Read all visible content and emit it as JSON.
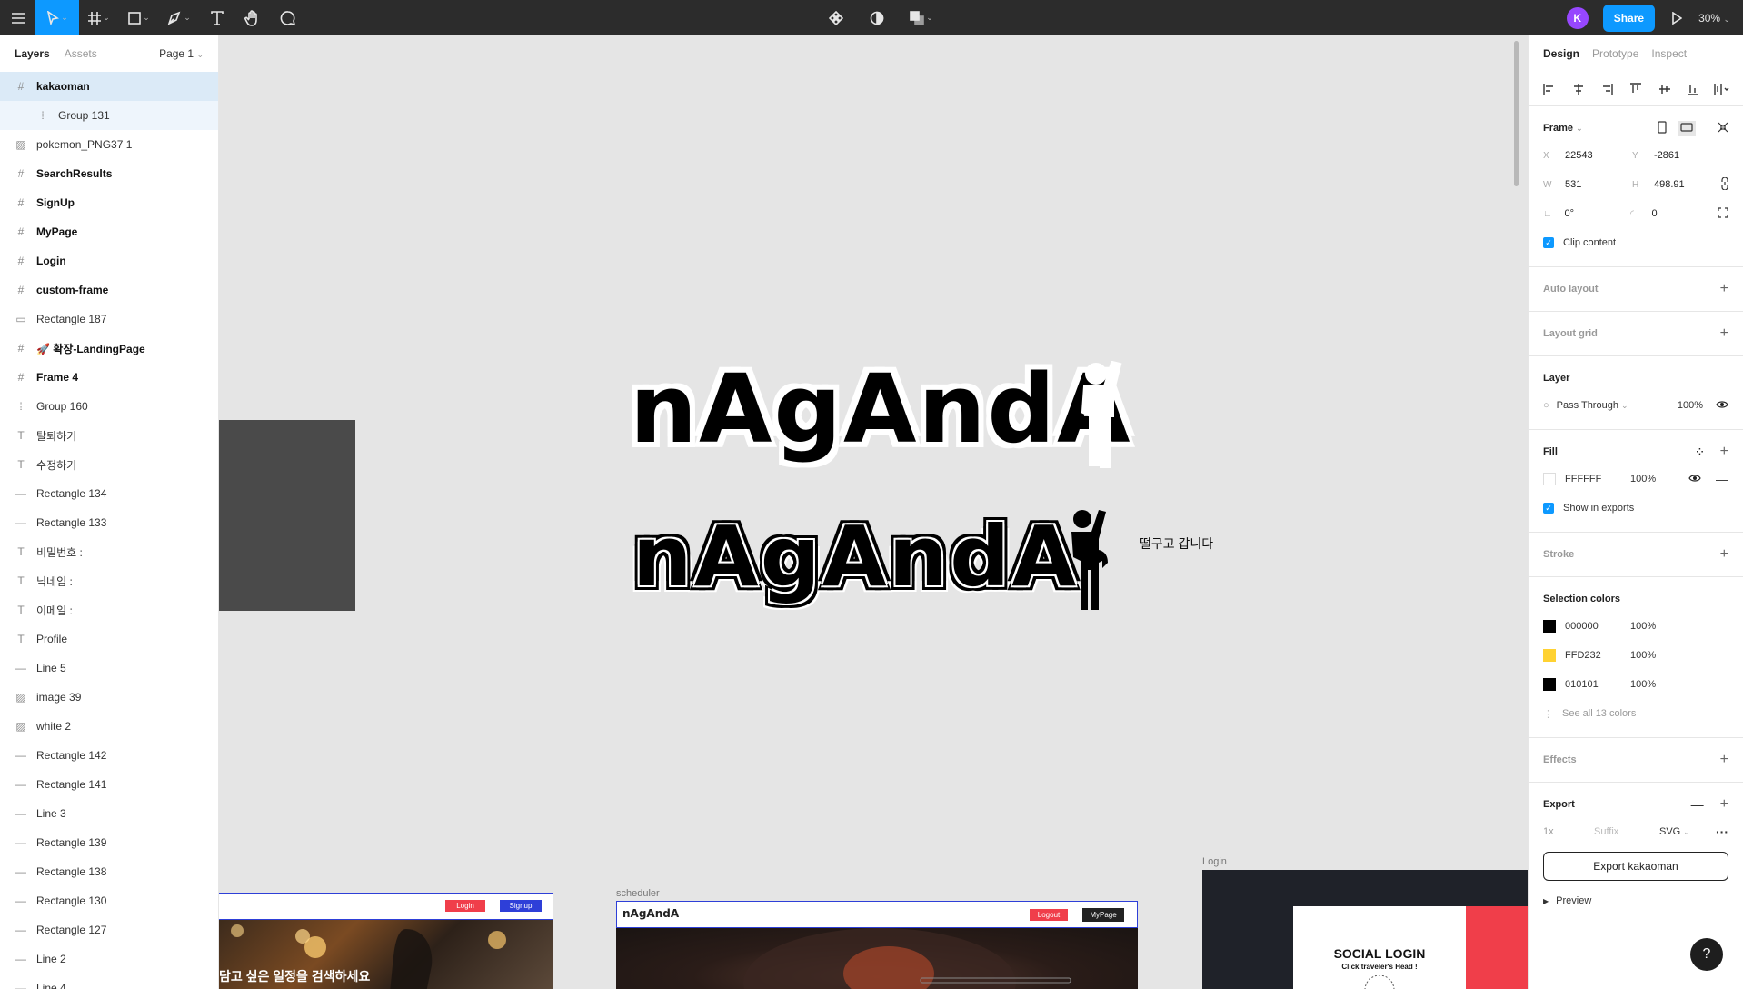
{
  "toolbar": {
    "tools": [
      {
        "name": "main-menu",
        "icon": "hamburger-icon"
      },
      {
        "name": "move-tool",
        "icon": "cursor-icon"
      },
      {
        "name": "frame-tool",
        "icon": "frame-icon"
      },
      {
        "name": "shape-tool",
        "icon": "rectangle-icon"
      },
      {
        "name": "pen-tool",
        "icon": "pen-icon"
      },
      {
        "name": "text-tool",
        "icon": "text-icon"
      },
      {
        "name": "hand-tool",
        "icon": "hand-icon"
      },
      {
        "name": "comment-tool",
        "icon": "comment-icon"
      }
    ],
    "center_icons": [
      "component-icon",
      "contrast-icon",
      "boolean-icon"
    ],
    "avatar_initial": "K",
    "share_label": "Share",
    "zoom": "30%"
  },
  "left_panel": {
    "tabs": [
      "Layers",
      "Assets"
    ],
    "page": "Page 1",
    "layers": [
      {
        "name": "kakaoman",
        "icon": "frame-icon",
        "bold": true,
        "state": "selected"
      },
      {
        "name": "Group 131",
        "icon": "group-icon",
        "bold": false,
        "state": "child"
      },
      {
        "name": "pokemon_PNG37 1",
        "icon": "image-icon",
        "bold": false,
        "state": ""
      },
      {
        "name": "SearchResults",
        "icon": "frame-icon",
        "bold": true,
        "state": ""
      },
      {
        "name": "SignUp",
        "icon": "frame-icon",
        "bold": true,
        "state": ""
      },
      {
        "name": "MyPage",
        "icon": "frame-icon",
        "bold": true,
        "state": ""
      },
      {
        "name": "Login",
        "icon": "frame-icon",
        "bold": true,
        "state": ""
      },
      {
        "name": "custom-frame",
        "icon": "frame-icon",
        "bold": true,
        "state": ""
      },
      {
        "name": "Rectangle 187",
        "icon": "rectangle-icon",
        "bold": false,
        "state": ""
      },
      {
        "name": "🚀 확장-LandingPage",
        "icon": "frame-icon",
        "bold": true,
        "state": ""
      },
      {
        "name": "Frame 4",
        "icon": "frame-icon",
        "bold": true,
        "state": ""
      },
      {
        "name": "Group 160",
        "icon": "group-icon",
        "bold": false,
        "state": ""
      },
      {
        "name": "탈퇴하기",
        "icon": "text-icon",
        "bold": false,
        "state": ""
      },
      {
        "name": "수정하기",
        "icon": "text-icon",
        "bold": false,
        "state": ""
      },
      {
        "name": "Rectangle 134",
        "icon": "line-icon",
        "bold": false,
        "state": ""
      },
      {
        "name": "Rectangle 133",
        "icon": "line-icon",
        "bold": false,
        "state": ""
      },
      {
        "name": "비밀번호 :",
        "icon": "text-icon",
        "bold": false,
        "state": ""
      },
      {
        "name": "닉네임 :",
        "icon": "text-icon",
        "bold": false,
        "state": ""
      },
      {
        "name": "이메일 :",
        "icon": "text-icon",
        "bold": false,
        "state": ""
      },
      {
        "name": "Profile",
        "icon": "text-icon",
        "bold": false,
        "state": ""
      },
      {
        "name": "Line 5",
        "icon": "line-icon",
        "bold": false,
        "state": ""
      },
      {
        "name": "image 39",
        "icon": "image-icon",
        "bold": false,
        "state": ""
      },
      {
        "name": "white 2",
        "icon": "image-icon",
        "bold": false,
        "state": ""
      },
      {
        "name": "Rectangle 142",
        "icon": "line-icon",
        "bold": false,
        "state": ""
      },
      {
        "name": "Rectangle 141",
        "icon": "line-icon",
        "bold": false,
        "state": ""
      },
      {
        "name": "Line 3",
        "icon": "line-icon",
        "bold": false,
        "state": ""
      },
      {
        "name": "Rectangle 139",
        "icon": "line-icon",
        "bold": false,
        "state": ""
      },
      {
        "name": "Rectangle 138",
        "icon": "line-icon",
        "bold": false,
        "state": ""
      },
      {
        "name": "Rectangle 130",
        "icon": "line-icon",
        "bold": false,
        "state": ""
      },
      {
        "name": "Rectangle 127",
        "icon": "line-icon",
        "bold": false,
        "state": ""
      },
      {
        "name": "Line 2",
        "icon": "line-icon",
        "bold": false,
        "state": ""
      },
      {
        "name": "Line 4",
        "icon": "line-icon",
        "bold": false,
        "state": ""
      }
    ]
  },
  "canvas": {
    "logo_text": "nAgAndA",
    "note_text": "떨구고 갑니다",
    "frames": {
      "search_frame": {
        "login_btn": "Login",
        "signup_btn": "Signup",
        "photo_text": "담고 싶은 일정을 검색하세요"
      },
      "scheduler": {
        "label": "scheduler",
        "logo": "nAgAndA",
        "logout_btn": "Logout",
        "mypage_btn": "MyPage"
      },
      "login": {
        "label": "Login",
        "card_title": "SOCIAL LOGIN",
        "card_subtitle": "Click traveler's Head !"
      }
    },
    "colors": {
      "canvas": "#e5e5e5",
      "accent_red": "#f03e4a",
      "accent_blue": "#2e3fd8"
    }
  },
  "right_panel": {
    "tabs": [
      "Design",
      "Prototype",
      "Inspect"
    ],
    "frame": {
      "title": "Frame",
      "x_label": "X",
      "x": "22543",
      "y_label": "Y",
      "y": "-2861",
      "w_label": "W",
      "w": "531",
      "h_label": "H",
      "h": "498.91",
      "rotation": "0°",
      "radius": "0",
      "clip_content": "Clip content"
    },
    "auto_layout": "Auto layout",
    "layout_grid": "Layout grid",
    "layer": {
      "title": "Layer",
      "blend": "Pass Through",
      "opacity": "100%"
    },
    "fill": {
      "title": "Fill",
      "hex": "FFFFFF",
      "opacity": "100%",
      "color": "#FFFFFF",
      "show_in_exports": "Show in exports"
    },
    "stroke": "Stroke",
    "selection_colors": {
      "title": "Selection colors",
      "items": [
        {
          "hex": "000000",
          "opacity": "100%",
          "color": "#000000"
        },
        {
          "hex": "FFD232",
          "opacity": "100%",
          "color": "#FFD232"
        },
        {
          "hex": "010101",
          "opacity": "100%",
          "color": "#010101"
        }
      ],
      "see_all": "See all 13 colors"
    },
    "effects": "Effects",
    "export": {
      "title": "Export",
      "scale": "1x",
      "suffix_placeholder": "Suffix",
      "format": "SVG",
      "button_label": "Export kakaoman",
      "preview": "Preview"
    },
    "help": "?"
  }
}
